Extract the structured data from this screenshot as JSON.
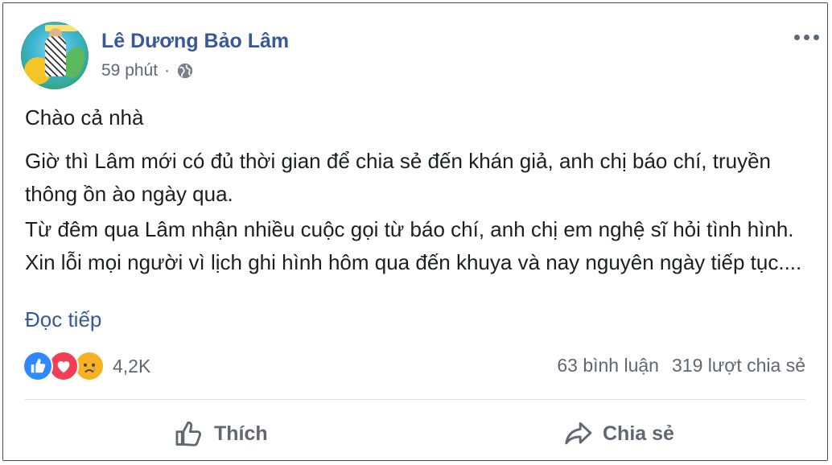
{
  "post": {
    "author_name": "Lê Dương Bảo Lâm",
    "timestamp": "59 phút",
    "separator": "·",
    "audience_icon": "globe-icon",
    "paragraphs": [
      "Chào cả nhà",
      "Giờ thì Lâm mới có đủ thời gian để chia sẻ đến khán giả, anh chị báo chí, truyền thông ồn ào ngày qua.",
      "Từ đêm qua Lâm nhận nhiều cuộc gọi từ báo chí, anh chị em nghệ sĩ hỏi tình hình. Xin lỗi mọi người vì lịch ghi hình hôm qua đến khuya và nay nguyên ngày tiếp tục...."
    ],
    "read_more": "Đọc tiếp"
  },
  "engagement": {
    "reaction_icons": [
      "like-icon",
      "love-icon",
      "sad-icon"
    ],
    "reaction_count": "4,2K",
    "comments": "63 bình luận",
    "shares": "319 lượt chia sẻ"
  },
  "actions": {
    "like_label": "Thích",
    "share_label": "Chia sẻ"
  },
  "colors": {
    "author": "#385898",
    "text": "#1c1e21",
    "muted": "#606770",
    "like": "#2e89ff",
    "love": "#f33e58",
    "sad": "#f7b125"
  }
}
